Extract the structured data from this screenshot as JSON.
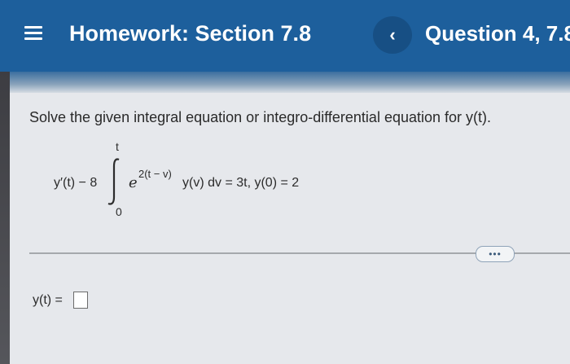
{
  "header": {
    "title": "Homework: Section 7.8",
    "question_label": "Question 4, 7.8.",
    "back_symbol": "‹"
  },
  "problem": {
    "prompt": "Solve the given integral equation or integro-differential equation for y(t).",
    "equation": {
      "lhs": "y′(t) − 8",
      "upper_limit": "t",
      "lower_limit": "0",
      "base": "e",
      "exponent": "2(t − v)",
      "rest": "y(v) dv = 3t,   y(0) = 2"
    }
  },
  "more_button": {
    "label": "•••"
  },
  "answer": {
    "label": "y(t) =",
    "value": ""
  },
  "colors": {
    "header": "#1d5f9c",
    "back_button": "#174f84",
    "background": "#e6e8ec"
  }
}
